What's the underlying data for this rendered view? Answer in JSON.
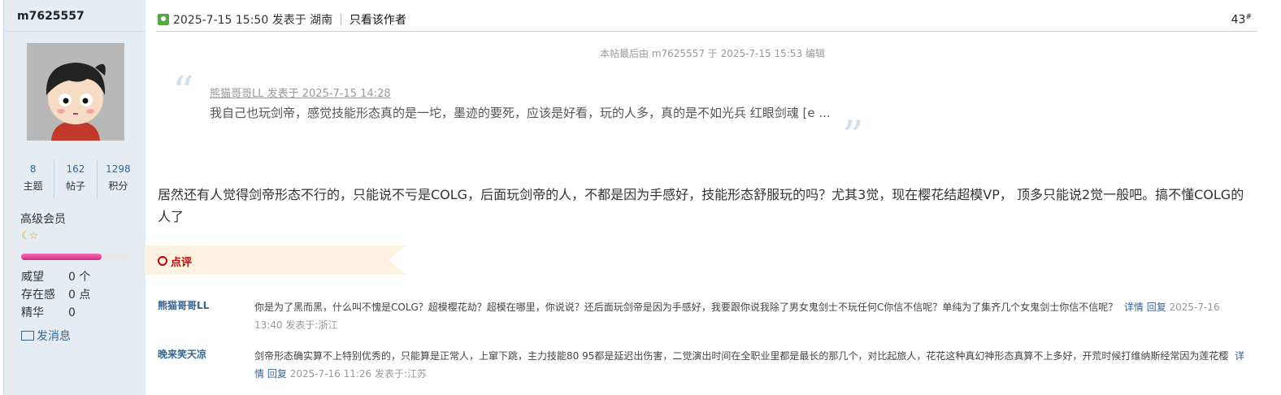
{
  "user": {
    "name": "m7625557",
    "stats": [
      {
        "value": "8",
        "label": "主题"
      },
      {
        "value": "162",
        "label": "帖子"
      },
      {
        "value": "1298",
        "label": "积分"
      }
    ],
    "group": "高级会员",
    "level_progress": 0.75,
    "fields": [
      {
        "key": "威望",
        "value": "0 个"
      },
      {
        "key": "存在感",
        "value": "0 点"
      },
      {
        "key": "精华",
        "value": "0"
      }
    ],
    "send_message": "发消息"
  },
  "post": {
    "meta": "2025-7-15 15:50 发表于 湖南",
    "only_author": "只看该作者",
    "floor": "43",
    "floor_sup": "#",
    "edited_note": "本帖最后由 m7625557 于 2025-7-15 15:53 编辑",
    "quote": {
      "header": "熊猫哥哥LL 发表于 2025-7-15 14:28",
      "text": "我自己也玩剑帝，感觉技能形态真的是一坨，墨迹的要死，应该是好看，玩的人多，真的是不如光兵 红眼剑魂 [e ..."
    },
    "content": "居然还有人觉得剑帝形态不行的，只能说不亏是COLG，后面玩剑帝的人，不都是因为手感好，技能形态舒服玩的吗？尤其3觉，现在樱花结超模VP， 顶多只能说2觉一般吧。搞不懂COLG的人了",
    "dianping_label": "点评",
    "comments": [
      {
        "author": "熊猫哥哥LL",
        "text": "你是为了黑而黑，什么叫不愧是COLG？超模樱花劫？超模在哪里，你说说？还后面玩剑帝是因为手感好，我要跟你说我除了男女鬼剑士不玩任何C你信不信呢？单纯为了集齐几个女鬼剑士你信不信呢？",
        "detail": "详情",
        "reply": "回复",
        "date": "2025-7-16 13:40 发表于:浙江"
      },
      {
        "author": "晚来笑天凉",
        "text": "剑帝形态确实算不上特别优秀的，只能算是正常人，上窜下跳，主力技能80 95都是延迟出伤害，二觉演出时间在全职业里都是最长的那几个，对比起旅人，花花这种真幻神形态真算不上多好，开荒时候打维纳斯经常因为莲花樱",
        "detail": "详情",
        "reply": "回复",
        "date": "2025-7-16 11:26 发表于:江苏"
      }
    ]
  }
}
